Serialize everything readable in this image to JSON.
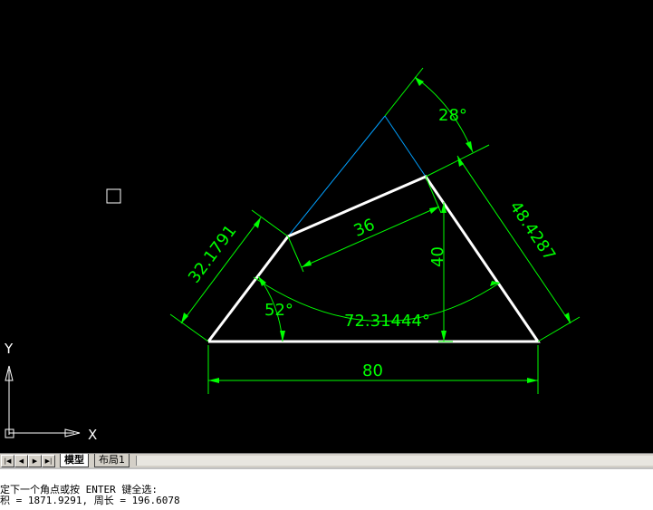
{
  "drawing": {
    "dimensions": {
      "bottom_length": "80",
      "top_length": "36",
      "left_side": "32.1791",
      "right_side": "48.4287",
      "height": "40",
      "left_angle": "52°",
      "top_angle": "28°",
      "arc_angle": "72.31444°"
    },
    "ucs": {
      "x_label": "X",
      "y_label": "Y"
    },
    "colors": {
      "background": "#000000",
      "geometry": "#ffffff",
      "dimension": "#00ff00",
      "construction": "#00a0ff"
    }
  },
  "tabs": {
    "nav": [
      "|◀",
      "◀",
      "▶",
      "▶|"
    ],
    "model": "模型",
    "layout1": "布局1"
  },
  "command": {
    "line1": "定下一个角点或按 ENTER 键全选:",
    "line2": "积 = 1871.9291, 周长 = 196.6078"
  }
}
